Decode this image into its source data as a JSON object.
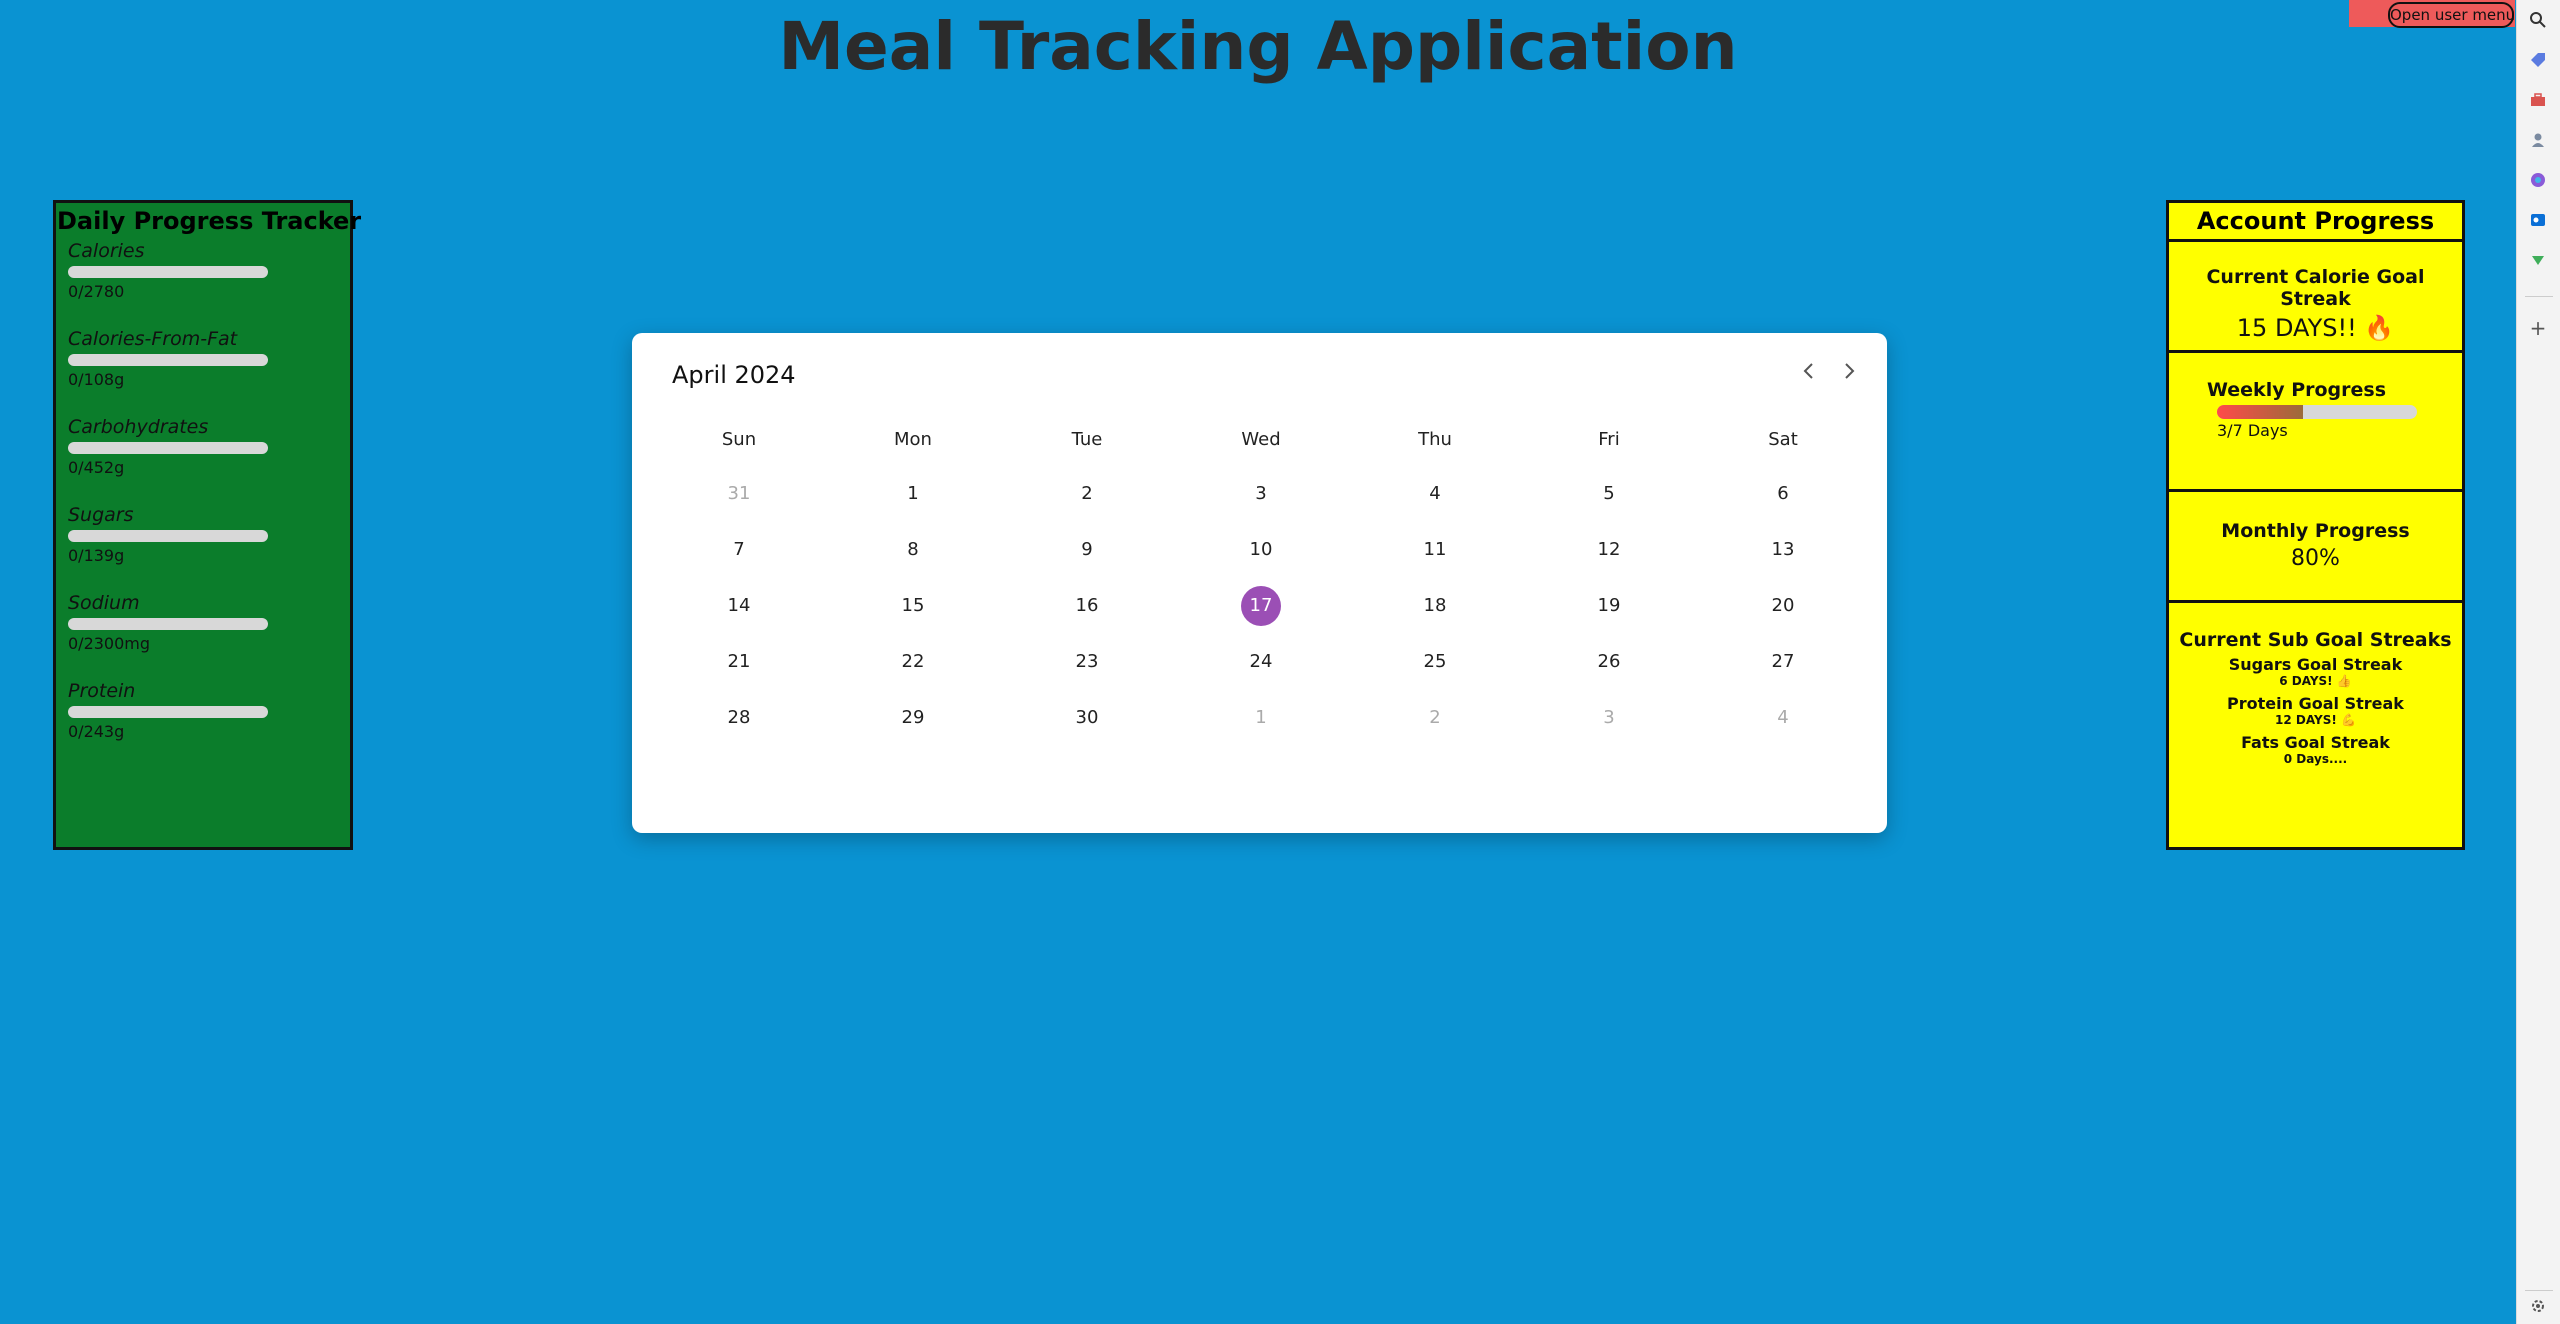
{
  "app": {
    "title": "Meal Tracking Application"
  },
  "user_menu": {
    "label": "Open user menu"
  },
  "daily": {
    "title": "Daily Progress Tracker",
    "nutrients": [
      {
        "name": "Calories",
        "value": "0/2780",
        "progress": 0
      },
      {
        "name": "Calories-From-Fat",
        "value": "0/108g",
        "progress": 0
      },
      {
        "name": "Carbohydrates",
        "value": "0/452g",
        "progress": 0
      },
      {
        "name": "Sugars",
        "value": "0/139g",
        "progress": 0
      },
      {
        "name": "Sodium",
        "value": "0/2300mg",
        "progress": 0
      },
      {
        "name": "Protein",
        "value": "0/243g",
        "progress": 0
      }
    ]
  },
  "calendar": {
    "month": "April 2024",
    "weekdays": [
      "Sun",
      "Mon",
      "Tue",
      "Wed",
      "Thu",
      "Fri",
      "Sat"
    ],
    "weeks": [
      [
        "31",
        "1",
        "2",
        "3",
        "4",
        "5",
        "6"
      ],
      [
        "7",
        "8",
        "9",
        "10",
        "11",
        "12",
        "13"
      ],
      [
        "14",
        "15",
        "16",
        "17",
        "18",
        "19",
        "20"
      ],
      [
        "21",
        "22",
        "23",
        "24",
        "25",
        "26",
        "27"
      ],
      [
        "28",
        "29",
        "30",
        "1",
        "2",
        "3",
        "4"
      ]
    ],
    "selected": "17",
    "prev_icon": "chevron-left-icon",
    "next_icon": "chevron-right-icon"
  },
  "account": {
    "title": "Account Progress",
    "calorie_streak": {
      "heading": "Current Calorie Goal Streak",
      "value": "15 DAYS!! 🔥"
    },
    "weekly": {
      "heading": "Weekly Progress",
      "value": "3/7 Days",
      "progress": 0.43
    },
    "monthly": {
      "heading": "Monthly Progress",
      "value": "80%"
    },
    "sub_streaks": {
      "heading": "Current Sub Goal Streaks",
      "items": [
        {
          "name": "Sugars Goal Streak",
          "value": "6 DAYS! 👍"
        },
        {
          "name": "Protein Goal Streak",
          "value": "12 DAYS! 💪"
        },
        {
          "name": "Fats Goal Streak",
          "value": "0 Days...."
        }
      ]
    }
  },
  "edge_bar": {
    "icons": [
      "search-icon",
      "tag-icon",
      "toolbox-icon",
      "people-icon",
      "copilot-icon",
      "outlook-icon",
      "drive-icon",
      "add-icon",
      "settings-icon"
    ]
  },
  "colors": {
    "background": "#0a93d2",
    "daily_panel": "#0b7d2b",
    "account_panel": "#ffff00",
    "selected_day": "#9b4fb5",
    "user_menu_bg": "#ee5a5a"
  }
}
